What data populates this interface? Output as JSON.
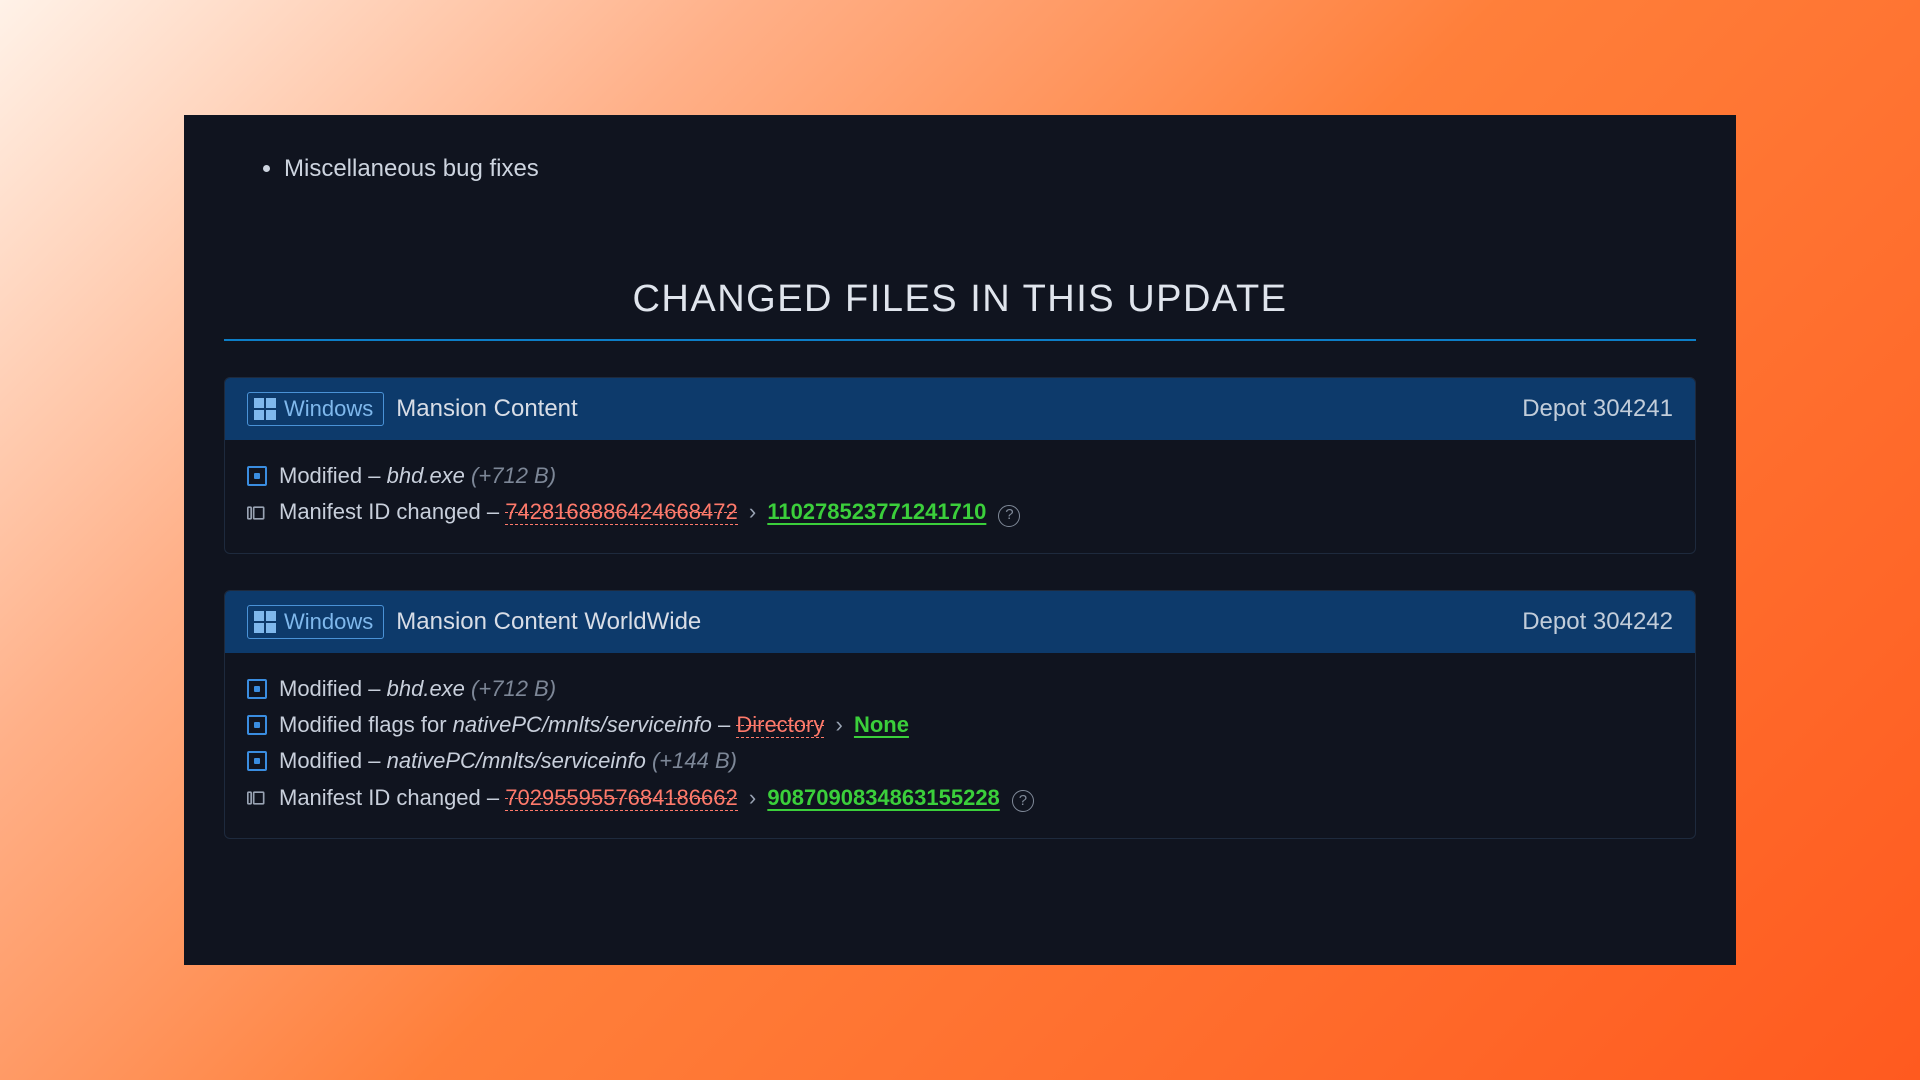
{
  "changelog": {
    "items": [
      "Miscellaneous bug fixes"
    ]
  },
  "section_title": "CHANGED FILES IN THIS UPDATE",
  "os_label": "Windows",
  "depots": [
    {
      "name": "Mansion Content",
      "id_label": "Depot 304241",
      "changes": [
        {
          "type": "modified",
          "label": "Modified",
          "file": "bhd.exe",
          "size": "(+712 B)"
        },
        {
          "type": "manifest",
          "label": "Manifest ID changed",
          "old": "7428168886424668472",
          "new": "110278523771241710"
        }
      ]
    },
    {
      "name": "Mansion Content WorldWide",
      "id_label": "Depot 304242",
      "changes": [
        {
          "type": "modified",
          "label": "Modified",
          "file": "bhd.exe",
          "size": "(+712 B)"
        },
        {
          "type": "flags",
          "label": "Modified flags for",
          "file": "nativePC/mnlts/serviceinfo",
          "old": "Directory",
          "new": "None"
        },
        {
          "type": "modified",
          "label": "Modified",
          "file": "nativePC/mnlts/serviceinfo",
          "size": "(+144 B)"
        },
        {
          "type": "manifest",
          "label": "Manifest ID changed",
          "old": "7029559557684186662",
          "new": "9087090834863155228"
        }
      ]
    }
  ],
  "help_glyph": "?"
}
